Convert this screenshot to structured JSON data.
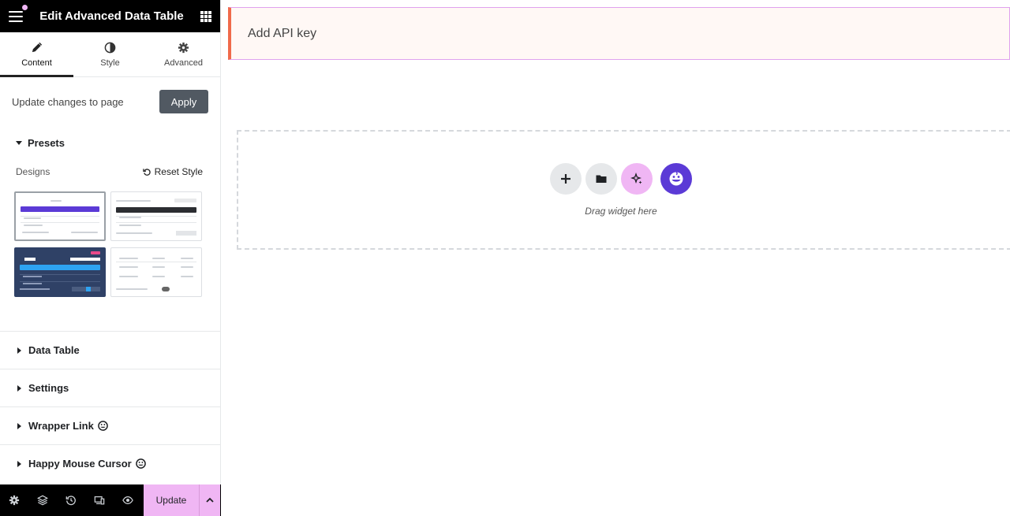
{
  "header": {
    "title": "Edit Advanced Data Table"
  },
  "tabs": [
    {
      "label": "Content",
      "icon": "pencil-icon"
    },
    {
      "label": "Style",
      "icon": "half-circle-icon"
    },
    {
      "label": "Advanced",
      "icon": "gear-icon"
    }
  ],
  "apply_row": {
    "label": "Update changes to page",
    "button": "Apply"
  },
  "presets": {
    "title": "Presets",
    "designs_label": "Designs",
    "reset_label": "Reset Style"
  },
  "sections": [
    {
      "label": "Data Table"
    },
    {
      "label": "Settings"
    },
    {
      "label": "Wrapper Link",
      "badge_icon": "happy-addons-icon"
    },
    {
      "label": "Happy Mouse Cursor",
      "badge_icon": "happy-addons-icon"
    }
  ],
  "footer": {
    "update_label": "Update"
  },
  "preview": {
    "api_text": "Add API key",
    "drop_text": "Drag widget here"
  },
  "colors": {
    "header_bg": "#000000",
    "accent_pink": "#f0b6f4",
    "happy_purple": "#5b3ad6",
    "warning_border": "#f06a4a",
    "apply_bg": "#515962"
  }
}
